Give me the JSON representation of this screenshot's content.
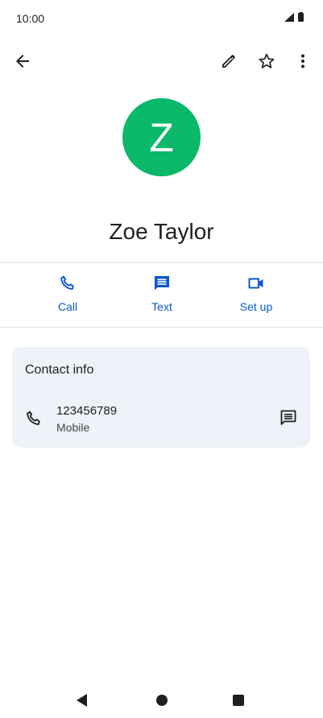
{
  "status_bar": {
    "time": "10:00",
    "icons": [
      "cellular-signal-icon",
      "battery-icon"
    ]
  },
  "app_bar": {
    "back_icon": "arrow-back-icon",
    "edit_icon": "pencil-icon",
    "favorite_icon": "star-outline-icon",
    "more_icon": "more-vert-icon"
  },
  "contact": {
    "initial": "Z",
    "name": "Zoe Taylor",
    "avatar_color": "#09b868"
  },
  "actions": [
    {
      "label": "Call",
      "icon": "phone-icon"
    },
    {
      "label": "Text",
      "icon": "message-icon"
    },
    {
      "label": "Set up",
      "icon": "videocam-icon"
    }
  ],
  "contact_info": {
    "title": "Contact info",
    "phone_number": "123456789",
    "phone_type": "Mobile"
  },
  "colors": {
    "accent": "#0b57d0",
    "card_background": "#eef2f9",
    "divider": "#e0e0e0"
  },
  "nav_bar": {
    "icons": [
      "nav-back-icon",
      "nav-home-icon",
      "nav-recents-icon"
    ]
  }
}
